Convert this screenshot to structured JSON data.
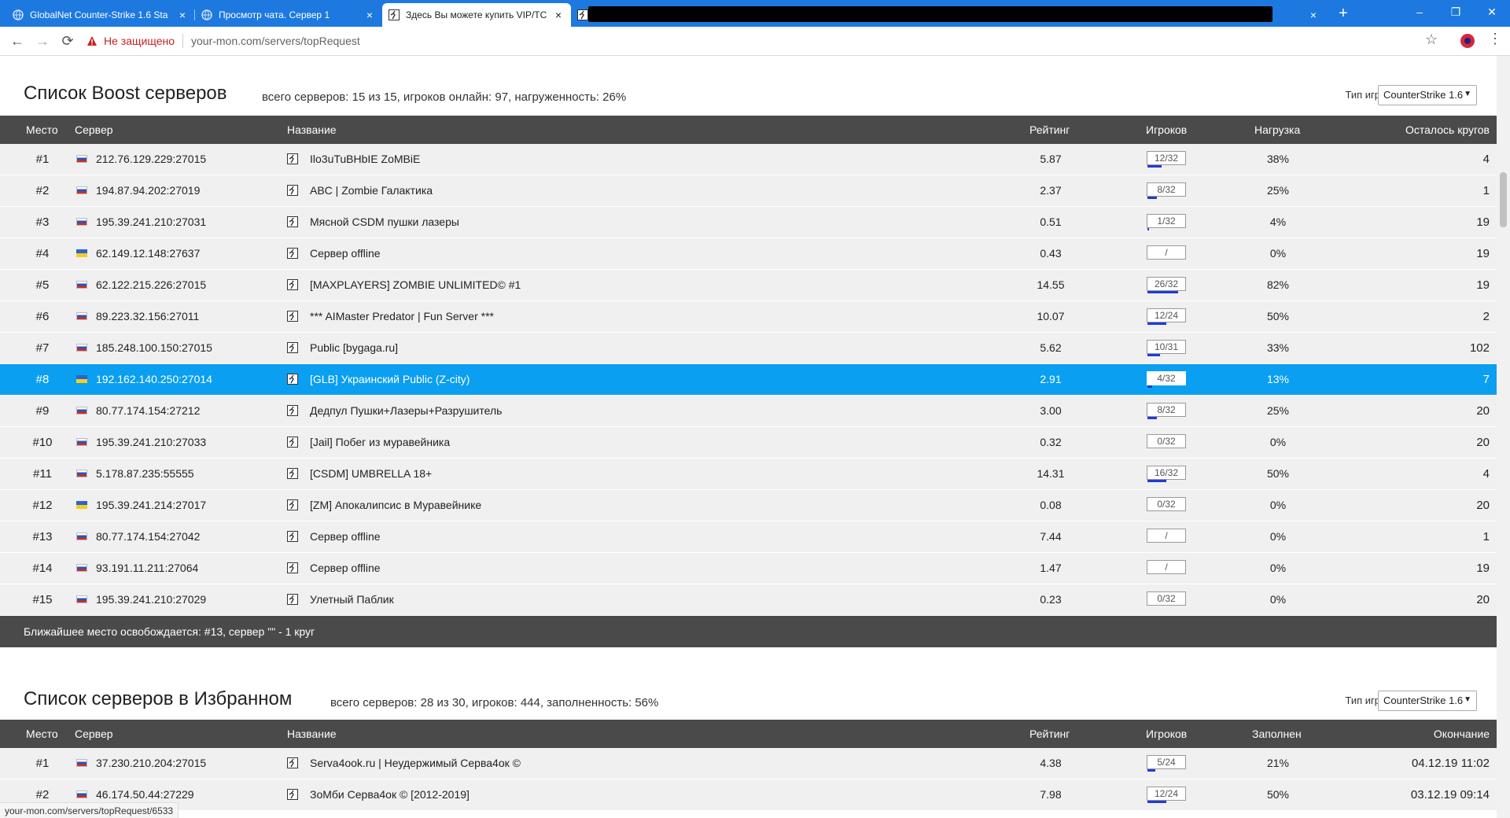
{
  "browser": {
    "tabs": [
      {
        "label": "GlobalNet Counter-Strike 1.6 Sta",
        "active": false
      },
      {
        "label": "Просмотр чата. Сервер 1",
        "active": false
      },
      {
        "label": "Здесь Вы можете купить VIP/TC",
        "active": true
      }
    ],
    "close_glyph": "×",
    "new_tab_glyph": "+",
    "window_buttons": [
      "–",
      "❐",
      "✕"
    ],
    "nav": {
      "back": "←",
      "forward": "→",
      "reload": "⟳"
    },
    "not_secure": "Не защищено",
    "url": "your-mon.com/servers/topRequest",
    "status_url": "your-mon.com/servers/topRequest/6533",
    "bookmark_star": "☆",
    "menu": "⋮"
  },
  "boost": {
    "title": "Список Boost серверов",
    "summary": "всего серверов: 15 из 15, игроков онлайн: 97, нагруженность: 26%",
    "game_type_label": "Тип игры:",
    "game_type_value": "CounterStrike 1.6",
    "headers": {
      "place": "Место",
      "server": "Сервер",
      "name": "Название",
      "rating": "Рейтинг",
      "players": "Игроков",
      "load": "Нагрузка",
      "last": "Осталось кругов"
    },
    "rows": [
      {
        "place": "#1",
        "flag": "ru",
        "ip": "212.76.129.229:27015",
        "name": "Ilo3uTuBHbIE ZoMBiE",
        "rating": "5.87",
        "players": "12/32",
        "fill": 0.38,
        "load": "38%",
        "last": "4"
      },
      {
        "place": "#2",
        "flag": "ru",
        "ip": "194.87.94.202:27019",
        "name": "ABC | Zombie Галактика",
        "rating": "2.37",
        "players": "8/32",
        "fill": 0.25,
        "load": "25%",
        "last": "1"
      },
      {
        "place": "#3",
        "flag": "ru",
        "ip": "195.39.241.210:27031",
        "name": "Мясной CSDM пушки лазеры",
        "rating": "0.51",
        "players": "1/32",
        "fill": 0.04,
        "load": "4%",
        "last": "19"
      },
      {
        "place": "#4",
        "flag": "ua",
        "ip": "62.149.12.148:27637",
        "name": "Сервер offline",
        "rating": "0.43",
        "players": "/",
        "fill": 0,
        "load": "0%",
        "last": "19"
      },
      {
        "place": "#5",
        "flag": "ru",
        "ip": "62.122.215.226:27015",
        "name": "[MAXPLAYERS] ZOMBIE UNLIMITED© #1",
        "rating": "14.55",
        "players": "26/32",
        "fill": 0.82,
        "load": "82%",
        "last": "19"
      },
      {
        "place": "#6",
        "flag": "ru",
        "ip": "89.223.32.156:27011",
        "name": "*** AIMaster Predator | Fun Server ***",
        "rating": "10.07",
        "players": "12/24",
        "fill": 0.5,
        "load": "50%",
        "last": "2"
      },
      {
        "place": "#7",
        "flag": "ru",
        "ip": "185.248.100.150:27015",
        "name": "Public [bygaga.ru]",
        "rating": "5.62",
        "players": "10/31",
        "fill": 0.33,
        "load": "33%",
        "last": "102"
      },
      {
        "place": "#8",
        "flag": "ua",
        "ip": "192.162.140.250:27014",
        "name": "[GLB] Украинский Public (Z-city)",
        "rating": "2.91",
        "players": "4/32",
        "fill": 0.13,
        "load": "13%",
        "last": "7",
        "highlight": true
      },
      {
        "place": "#9",
        "flag": "ru",
        "ip": "80.77.174.154:27212",
        "name": "Дедпул Пушки+Лазеры+Разрушитель",
        "rating": "3.00",
        "players": "8/32",
        "fill": 0.25,
        "load": "25%",
        "last": "20"
      },
      {
        "place": "#10",
        "flag": "ru",
        "ip": "195.39.241.210:27033",
        "name": "[Jail] Побег из муравейника",
        "rating": "0.32",
        "players": "0/32",
        "fill": 0,
        "load": "0%",
        "last": "20"
      },
      {
        "place": "#11",
        "flag": "ru",
        "ip": "5.178.87.235:55555",
        "name": "[CSDM] UMBRELLA 18+",
        "rating": "14.31",
        "players": "16/32",
        "fill": 0.5,
        "load": "50%",
        "last": "4"
      },
      {
        "place": "#12",
        "flag": "ua",
        "ip": "195.39.241.214:27017",
        "name": "[ZM] Апокалипсис в Муравейнике",
        "rating": "0.08",
        "players": "0/32",
        "fill": 0,
        "load": "0%",
        "last": "20"
      },
      {
        "place": "#13",
        "flag": "ru",
        "ip": "80.77.174.154:27042",
        "name": "Сервер offline",
        "rating": "7.44",
        "players": "/",
        "fill": 0,
        "load": "0%",
        "last": "1"
      },
      {
        "place": "#14",
        "flag": "ru",
        "ip": "93.191.11.211:27064",
        "name": "Сервер offline",
        "rating": "1.47",
        "players": "/",
        "fill": 0,
        "load": "0%",
        "last": "19"
      },
      {
        "place": "#15",
        "flag": "ru",
        "ip": "195.39.241.210:27029",
        "name": "Улетный Паблик",
        "rating": "0.23",
        "players": "0/32",
        "fill": 0,
        "load": "0%",
        "last": "20"
      }
    ],
    "footer": "Ближайшее место освобождается: #13, сервер \"\" - 1 круг"
  },
  "favorites": {
    "title": "Список серверов в Избранном",
    "summary": "всего серверов: 28 из 30, игроков: 444, заполненность: 56%",
    "game_type_label": "Тип игры:",
    "game_type_value": "CounterStrike 1.6",
    "headers": {
      "place": "Место",
      "server": "Сервер",
      "name": "Название",
      "rating": "Рейтинг",
      "players": "Игроков",
      "load": "Заполнен",
      "last": "Окончание"
    },
    "rows": [
      {
        "place": "#1",
        "flag": "ru",
        "ip": "37.230.210.204:27015",
        "name": "Serva4ook.ru | Неудержимый Серва4ок ©",
        "rating": "4.38",
        "players": "5/24",
        "fill": 0.21,
        "load": "21%",
        "last": "04.12.19 11:02"
      },
      {
        "place": "#2",
        "flag": "ru",
        "ip": "46.174.50.44:27229",
        "name": "ЗоМби Серва4ок © [2012-2019]",
        "rating": "7.98",
        "players": "12/24",
        "fill": 0.5,
        "load": "50%",
        "last": "03.12.19 09:14"
      }
    ]
  },
  "colors": {
    "tabbar": "#1d79df",
    "table_header": "#4a4a4a",
    "highlight": "#0a9ff0",
    "fill_bar": "#1d3bd8",
    "not_secure": "#c5221f"
  }
}
